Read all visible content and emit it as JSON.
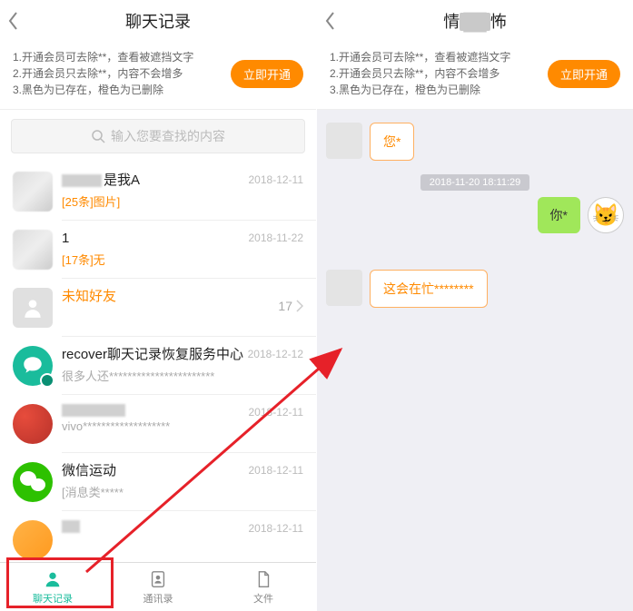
{
  "left": {
    "title": "聊天记录",
    "notice": {
      "l1": "1.开通会员可去除**，查看被遮挡文字",
      "l2": "2.开通会员只去除**，内容不会增多",
      "l3": "3.黑色为已存在，橙色为已删除",
      "btn": "立即开通"
    },
    "search_placeholder": "输入您要查找的内容",
    "rows": [
      {
        "name_suffix": "是我A",
        "sub": "[25条]图片]",
        "date": "2018-12-11"
      },
      {
        "name": "1",
        "sub": "[17条]无",
        "date": "2018-11-22"
      },
      {
        "name": "未知好友",
        "count": "17"
      },
      {
        "name": "recover聊天记录恢复服务中心",
        "sub": "很多人还***********************",
        "date": "2018-12-12"
      },
      {
        "sub": "vivo*******************",
        "date": "2018-12-11"
      },
      {
        "name": "微信运动",
        "sub": "[消息类*****",
        "date": "2018-12-11"
      },
      {
        "date": "2018-12-11"
      }
    ],
    "tabs": [
      {
        "label": "聊天记录"
      },
      {
        "label": "通讯录"
      },
      {
        "label": "文件"
      }
    ]
  },
  "right": {
    "title_prefix": "情",
    "title_suffix": "怖",
    "notice": {
      "l1": "1.开通会员可去除**，查看被遮挡文字",
      "l2": "2.开通会员只去除**，内容不会增多",
      "l3": "3.黑色为已存在，橙色为已删除",
      "btn": "立即开通"
    },
    "timestamp": "2018-11-20 18:11:29",
    "msgs": [
      {
        "side": "left",
        "text": "您*"
      },
      {
        "side": "right",
        "text": "你*"
      },
      {
        "side": "left",
        "text": "这会在忙********"
      }
    ]
  }
}
